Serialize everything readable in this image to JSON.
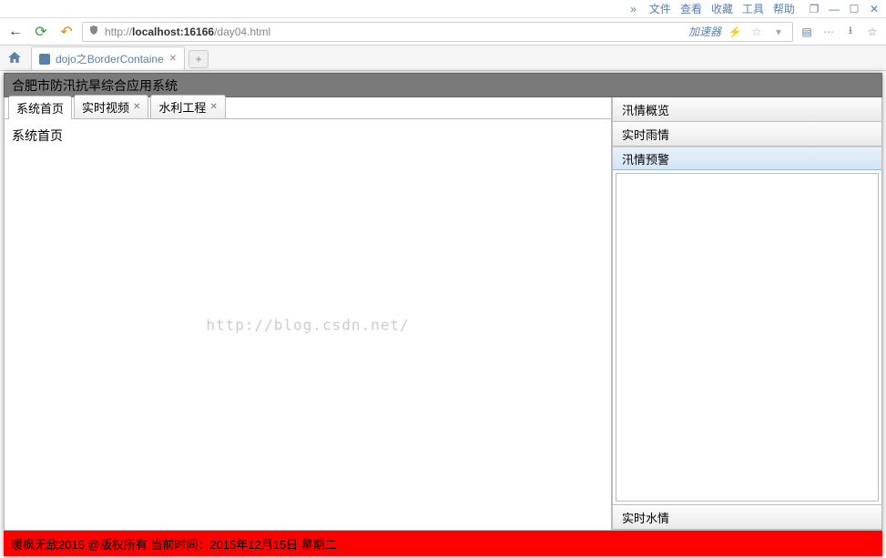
{
  "browser": {
    "menu": [
      "文件",
      "查看",
      "收藏",
      "工具",
      "帮助"
    ],
    "url_prefix": "http://",
    "url_host": "localhost:16166",
    "url_path": "/day04.html",
    "accelerator": "加速器",
    "tab_title": "dojo之BorderContaine"
  },
  "app": {
    "header_title": "合肥市防汛抗旱综合应用系统"
  },
  "tabs": [
    {
      "label": "系统首页",
      "closable": false,
      "active": true
    },
    {
      "label": "实时视频",
      "closable": true,
      "active": false
    },
    {
      "label": "水利工程",
      "closable": true,
      "active": false
    }
  ],
  "tab_content": "系统首页",
  "watermark": "http://blog.csdn.net/",
  "accordion": [
    {
      "label": "汛情概览",
      "active": false
    },
    {
      "label": "实时雨情",
      "active": false
    },
    {
      "label": "汛情预警",
      "active": true
    },
    {
      "label": "实时水情",
      "active": false
    }
  ],
  "footer": "暖枫无敌2015 @版权所有  当前时间：2015年12月15日  星期二"
}
